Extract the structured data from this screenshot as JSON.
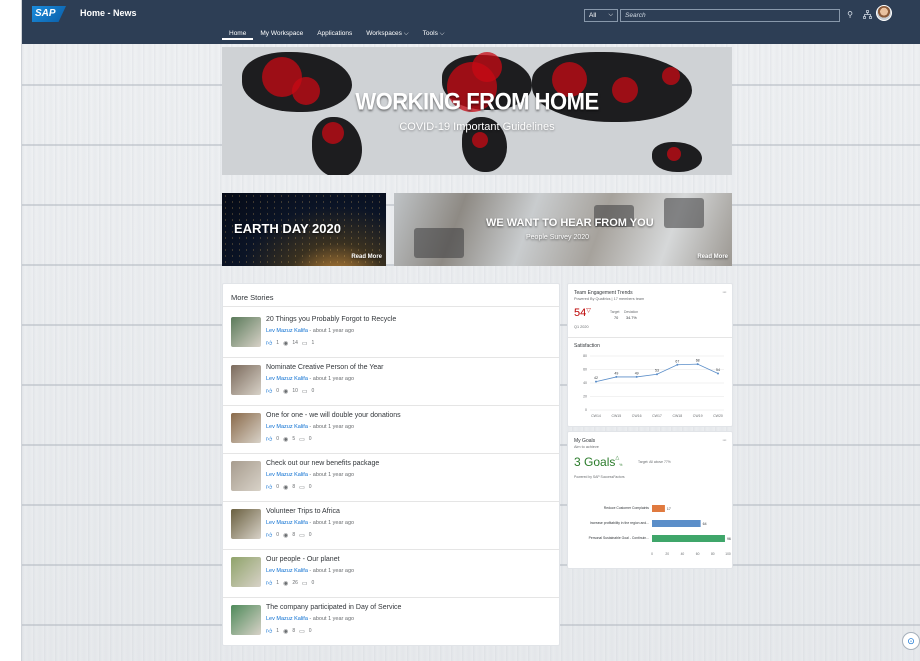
{
  "shell": {
    "logo": "SAP",
    "title": "Home - News",
    "nav": [
      "Home",
      "My Workspace",
      "Applications",
      "Workspaces ⌵",
      "Tools ⌵"
    ],
    "search_scope": "All",
    "search_placeholder": "Search",
    "icons": [
      "search-icon",
      "org-chart-icon",
      "bell-icon",
      "avatar"
    ]
  },
  "hero": {
    "title": "WORKING FROM HOME",
    "subtitle": "COVID-19 Important Guidelines"
  },
  "banners": {
    "earth": {
      "title": "EARTH DAY 2020",
      "read_more": "Read More"
    },
    "survey": {
      "title": "WE WANT TO HEAR FROM YOU",
      "subtitle": "People Survey 2020",
      "read_more": "Read More"
    }
  },
  "stories": {
    "title": "More Stories",
    "items": [
      {
        "title": "20 Things you Probably Forgot to Recycle",
        "author": "Lev Mazuz Kalifa",
        "time": "- about 1 year ago",
        "likes": "1",
        "views": "14",
        "comments": "1",
        "thumb": "#5a7a5a"
      },
      {
        "title": "Nominate Creative Person of the Year",
        "author": "Lev Mazuz Kalifa",
        "time": "- about 1 year ago",
        "likes": "0",
        "views": "10",
        "comments": "0",
        "thumb": "#7b6a5c"
      },
      {
        "title": "One for one - we will double your donations",
        "author": "Lev Mazuz Kalifa",
        "time": "- about 1 year ago",
        "likes": "0",
        "views": "5",
        "comments": "0",
        "thumb": "#8a6a4a"
      },
      {
        "title": "Check out our new benefits package",
        "author": "Lev Mazuz Kalifa",
        "time": "- about 1 year ago",
        "likes": "0",
        "views": "8",
        "comments": "0",
        "thumb": "#a79c8e"
      },
      {
        "title": "Volunteer Trips to Africa",
        "author": "Lev Mazuz Kalifa",
        "time": "- about 1 year ago",
        "likes": "0",
        "views": "8",
        "comments": "0",
        "thumb": "#6a6040"
      },
      {
        "title": "Our people - Our planet",
        "author": "Lev Mazuz Kalifa",
        "time": "- about 1 year ago",
        "likes": "1",
        "views": "26",
        "comments": "0",
        "thumb": "#8fa36a"
      },
      {
        "title": "The company participated in Day of Service",
        "author": "Lev Mazuz Kalifa",
        "time": "- about 1 year ago",
        "likes": "1",
        "views": "8",
        "comments": "0",
        "thumb": "#4e8a5a"
      }
    ]
  },
  "engagement": {
    "title": "Team Engagement Trends",
    "subtitle": "Powered By Qualtrics | 17 members team",
    "kpi": "54",
    "trend": "▽",
    "target_label": "Target",
    "target_value": "70",
    "deviation_label": "Deviation",
    "deviation_value": "34.7%",
    "period": "Q1 2020",
    "chart_title": "Satisfaction"
  },
  "goals": {
    "title": "My Goals",
    "subtitle": "Aim to achieve",
    "kpi": "3 Goals",
    "trend": "△",
    "kpi_unit": "%",
    "target": "Target: All above 77%",
    "powered": "Powered by SAP SuccessFactors"
  },
  "chart_data": [
    {
      "type": "line",
      "title": "Satisfaction",
      "categories": [
        "CW14",
        "CW15",
        "CW16",
        "CW17",
        "CW18",
        "CW19",
        "CW20"
      ],
      "series": [
        {
          "values": [
            42,
            49,
            49,
            53,
            67,
            68,
            54
          ]
        }
      ],
      "ylim": [
        0,
        80
      ],
      "yticks": [
        0,
        20,
        40,
        60,
        80
      ],
      "grid": true,
      "colors": [
        "#5b8ec9"
      ]
    },
    {
      "type": "bar",
      "orientation": "horizontal",
      "categories": [
        "Reduce Customer Complaints",
        "Increase profitability in the region and...",
        "Personal Sustainable Goal - Continuin..."
      ],
      "values": [
        17,
        64,
        96
      ],
      "colors": [
        "#e07a3f",
        "#5b8ec9",
        "#3fa66a"
      ],
      "xlim": [
        0,
        100
      ],
      "xticks": [
        0,
        20,
        40,
        60,
        80,
        100
      ]
    }
  ]
}
